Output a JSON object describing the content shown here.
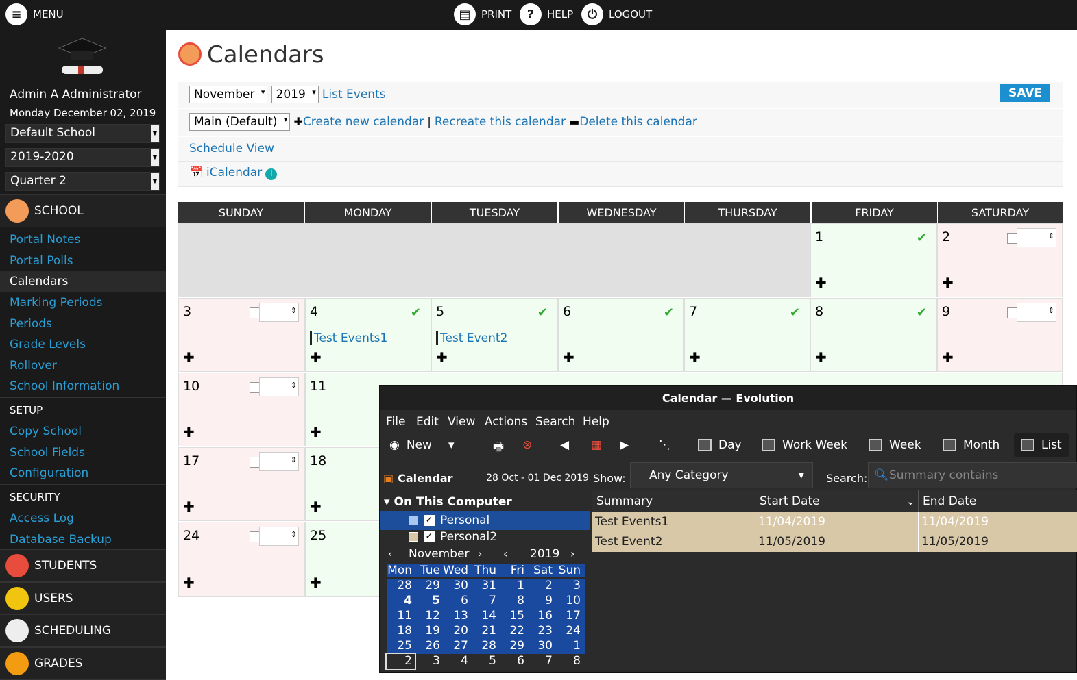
{
  "topbar": {
    "menu": "MENU",
    "print": "PRINT",
    "help": "HELP",
    "logout": "LOGOUT"
  },
  "sidebar": {
    "user": "Admin A Administrator",
    "date": "Monday December 02, 2019",
    "school": "Default School",
    "year": "2019-2020",
    "quarter": "Quarter 2",
    "school_section": "SCHOOL",
    "school_links": [
      "Portal Notes",
      "Portal Polls",
      "Calendars",
      "Marking Periods",
      "Periods",
      "Grade Levels",
      "Rollover",
      "School Information"
    ],
    "setup_label": "SETUP",
    "setup_links": [
      "Copy School",
      "School Fields",
      "Configuration"
    ],
    "security_label": "SECURITY",
    "security_links": [
      "Access Log",
      "Database Backup"
    ],
    "sections": [
      "STUDENTS",
      "USERS",
      "SCHEDULING",
      "GRADES"
    ]
  },
  "main": {
    "title": "Calendars",
    "month": "November",
    "year": "2019",
    "list_events": "List Events",
    "save": "SAVE",
    "calendar_select": "Main (Default)",
    "create": "Create new calendar",
    "sep": "|",
    "recreate": "Recreate this calendar",
    "delete": "Delete this calendar",
    "schedule_view": "Schedule View",
    "icalendar": "iCalendar",
    "days": [
      "SUNDAY",
      "MONDAY",
      "TUESDAY",
      "WEDNESDAY",
      "THURSDAY",
      "FRIDAY",
      "SATURDAY"
    ],
    "events": {
      "e4": "Test Events1",
      "e5": "Test Event2"
    },
    "nums": {
      "d1": "1",
      "d2": "2",
      "d3": "3",
      "d4": "4",
      "d5": "5",
      "d6": "6",
      "d7": "7",
      "d8": "8",
      "d9": "9",
      "d10": "10",
      "d11": "11",
      "d17": "17",
      "d18": "18",
      "d24": "24",
      "d25": "25"
    }
  },
  "evolution": {
    "title": "Calendar — Evolution",
    "menu": [
      "File",
      "Edit",
      "View",
      "Actions",
      "Search",
      "Help"
    ],
    "new": "New",
    "views": [
      "Day",
      "Work Week",
      "Week",
      "Month",
      "List"
    ],
    "pane_title": "Calendar",
    "range": "28 Oct - 01 Dec 2019",
    "show_label": "Show:",
    "category": "Any Category",
    "search_label": "Search:",
    "search_placeholder": "Summary contains",
    "group": "On This Computer",
    "cal1": "Personal",
    "cal2": "Personal2",
    "columns": [
      "Summary",
      "Start Date",
      "End Date"
    ],
    "rows": [
      [
        "Test Events1",
        "11/04/2019",
        "11/04/2019"
      ],
      [
        "Test Event2",
        "11/05/2019",
        "11/05/2019"
      ]
    ],
    "mini_month": "November",
    "mini_year": "2019",
    "mini_days": [
      "Mon",
      "Tue",
      "Wed",
      "Thu",
      "Fri",
      "Sat",
      "Sun"
    ],
    "mini_weeks": [
      [
        "28",
        "29",
        "30",
        "31",
        "1",
        "2",
        "3"
      ],
      [
        "4",
        "5",
        "6",
        "7",
        "8",
        "9",
        "10"
      ],
      [
        "11",
        "12",
        "13",
        "14",
        "15",
        "16",
        "17"
      ],
      [
        "18",
        "19",
        "20",
        "21",
        "22",
        "23",
        "24"
      ],
      [
        "25",
        "26",
        "27",
        "28",
        "29",
        "30",
        "1"
      ],
      [
        "2",
        "3",
        "4",
        "5",
        "6",
        "7",
        "8"
      ]
    ]
  }
}
